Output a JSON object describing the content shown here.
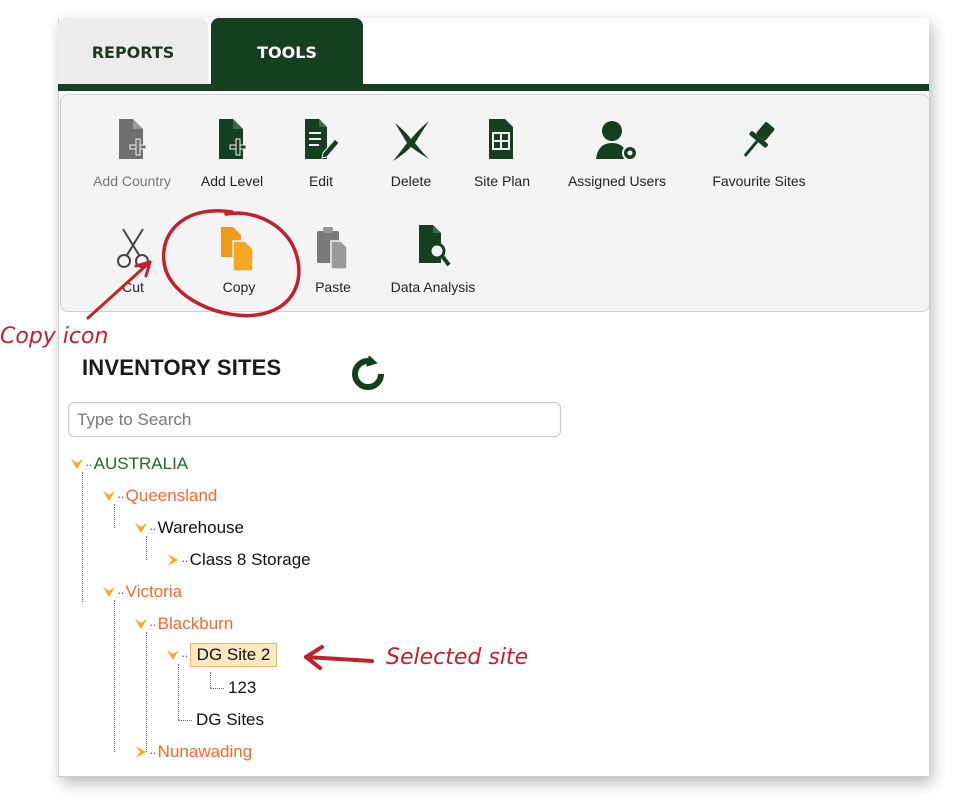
{
  "tabs": [
    {
      "label": "REPORTS"
    },
    {
      "label": "TOOLS"
    }
  ],
  "toolbar": {
    "row1": [
      {
        "label": "Add Country",
        "icon": "add-country-icon",
        "disabled": true
      },
      {
        "label": "Add Level",
        "icon": "add-level-icon"
      },
      {
        "label": "Edit",
        "icon": "edit-icon"
      },
      {
        "label": "Delete",
        "icon": "delete-icon"
      },
      {
        "label": "Site Plan",
        "icon": "site-plan-icon"
      },
      {
        "label": "Assigned Users",
        "icon": "assigned-users-icon"
      },
      {
        "label": "Favourite Sites",
        "icon": "pin-icon"
      }
    ],
    "row2": [
      {
        "label": "Cut",
        "icon": "scissors-icon"
      },
      {
        "label": "Copy",
        "icon": "copy-icon"
      },
      {
        "label": "Paste",
        "icon": "paste-icon"
      },
      {
        "label": "Data Analysis",
        "icon": "data-analysis-icon"
      }
    ]
  },
  "inventory": {
    "title": "INVENTORY SITES",
    "search_placeholder": "Type to Search"
  },
  "tree": {
    "australia": "AUSTRALIA",
    "queensland": "Queensland",
    "warehouse": "Warehouse",
    "class8": "Class 8 Storage",
    "victoria": "Victoria",
    "blackburn": "Blackburn",
    "dgsite2": "DG Site 2",
    "n123": "123",
    "dgsites": "DG Sites",
    "nunawading": "Nunawading"
  },
  "annotations": {
    "copy_icon": "Copy icon",
    "selected_site": "Selected site"
  },
  "colors": {
    "brand_green": "#14401f",
    "tree_orange": "#f26b2a",
    "tree_green": "#1d6b28",
    "arrow_orange": "#f5a623",
    "annotation_red": "#c3202c",
    "selected_bg": "#fde9bf"
  }
}
